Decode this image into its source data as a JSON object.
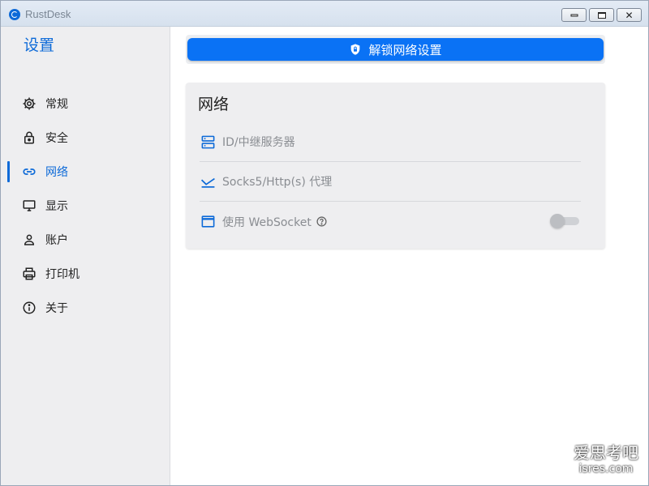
{
  "window": {
    "title": "RustDesk",
    "controls": {
      "minimize": "minimize",
      "maximize": "maximize",
      "close": "✕"
    }
  },
  "sidebar": {
    "title": "设置",
    "items": [
      {
        "label": "常规",
        "icon": "gear-icon"
      },
      {
        "label": "安全",
        "icon": "lock-icon"
      },
      {
        "label": "网络",
        "icon": "link-icon",
        "active": true
      },
      {
        "label": "显示",
        "icon": "monitor-icon"
      },
      {
        "label": "账户",
        "icon": "person-icon"
      },
      {
        "label": "打印机",
        "icon": "printer-icon"
      },
      {
        "label": "关于",
        "icon": "info-icon"
      }
    ]
  },
  "main": {
    "unlock_button": {
      "label": "解锁网络设置",
      "icon": "shield-icon"
    },
    "network_card": {
      "title": "网络",
      "rows": [
        {
          "label": "ID/中继服务器",
          "icon": "server-icon"
        },
        {
          "label": "Socks5/Http(s) 代理",
          "icon": "proxy-icon"
        },
        {
          "label": "使用 WebSocket",
          "icon": "window-icon",
          "toggle_on": false
        }
      ]
    }
  },
  "watermark": {
    "main": "爱思考吧",
    "sub": "isres.com"
  },
  "colors": {
    "accent": "#0d6ad8",
    "button": "#0a72f5",
    "sidebar_bg": "#eeeef0",
    "card_bg": "#eeeef0",
    "muted_text": "#8a8d92"
  }
}
